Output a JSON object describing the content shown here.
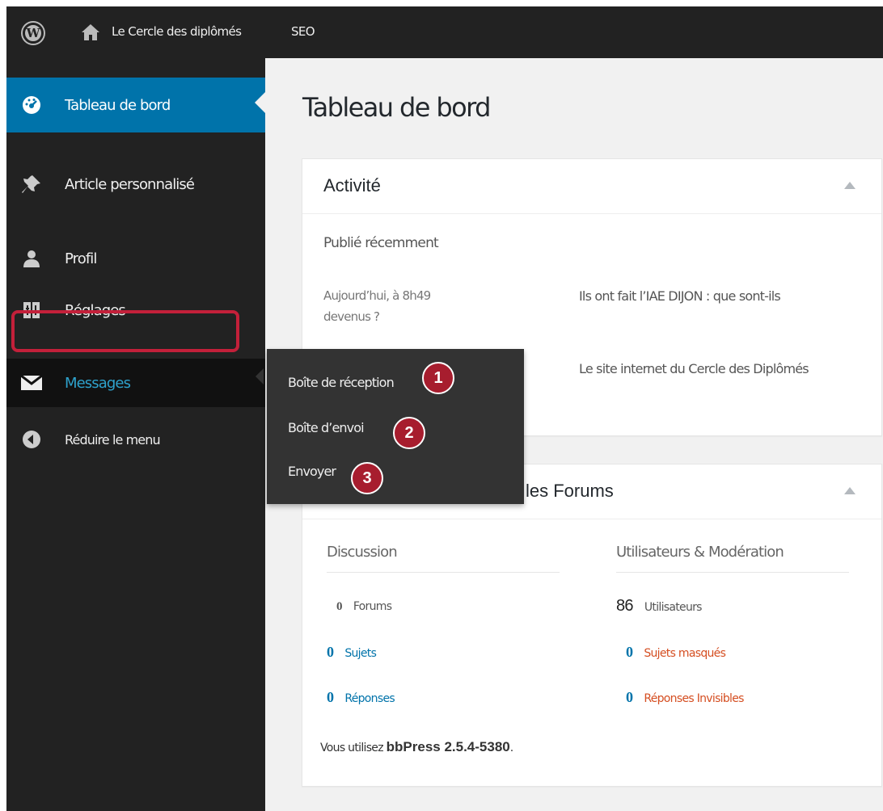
{
  "adminbar": {
    "site_name": "Le Cercle des diplômés",
    "seo": "SEO"
  },
  "sidebar": {
    "items": [
      {
        "label": "Tableau de bord",
        "icon": "dashboard-icon"
      },
      {
        "label": "Article personnalisé",
        "icon": "pin-icon"
      },
      {
        "label": "Profil",
        "icon": "user-icon"
      },
      {
        "label": "Réglages",
        "icon": "settings-icon"
      },
      {
        "label": "Messages",
        "icon": "envelope-icon"
      },
      {
        "label": "Réduire le menu",
        "icon": "collapse-icon"
      }
    ]
  },
  "flyout": {
    "items": [
      {
        "label": "Boîte de réception",
        "badge": "1"
      },
      {
        "label": "Boîte d’envoi",
        "badge": "2"
      },
      {
        "label": "Envoyer",
        "badge": "3"
      }
    ]
  },
  "main": {
    "title": "Tableau de bord",
    "activity": {
      "title": "Activité",
      "subtitle": "Publié récemment",
      "posts": [
        {
          "date": "Aujourd’hui, à 8h49",
          "title": "Ils ont fait l’IAE DIJON : que sont-ils devenus ?"
        },
        {
          "date": "",
          "title": "Le site internet du Cercle des Diplômés"
        }
      ]
    },
    "forums": {
      "title_suffix": "les Forums",
      "discussion_header": "Discussion",
      "users_header": "Utilisateurs & Modération",
      "discussion": [
        {
          "num": "0",
          "label": "Forums"
        },
        {
          "num": "0",
          "label": "Sujets"
        },
        {
          "num": "0",
          "label": "Réponses"
        }
      ],
      "users": [
        {
          "num": "86",
          "label": "Utilisateurs"
        },
        {
          "num": "0",
          "label": "Sujets masqués"
        },
        {
          "num": "0",
          "label": "Réponses Invisibles"
        }
      ],
      "footer_prefix": "Vous utilisez",
      "footer_version": "bbPress 2.5.4-5380",
      "footer_suffix": "."
    }
  },
  "colors": {
    "admin_bg": "#222222",
    "active_blue": "#0073aa",
    "link_blue": "#2ea2cc",
    "highlight_red": "#c3203a",
    "badge_red": "#a71d2e",
    "warning_red": "#d54e21"
  }
}
